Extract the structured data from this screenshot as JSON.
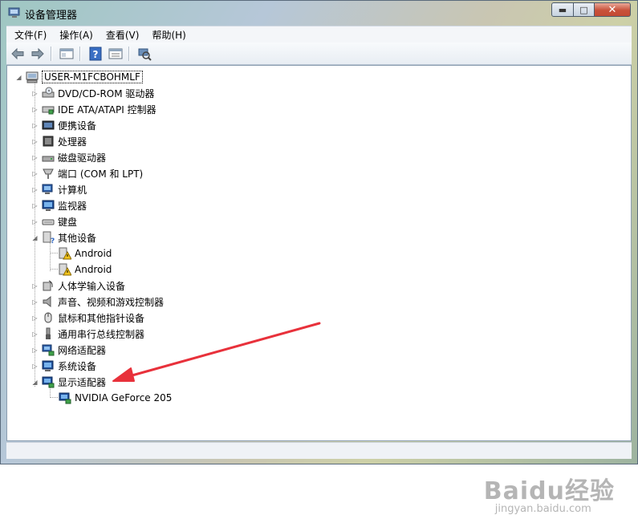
{
  "window": {
    "title": "设备管理器",
    "controls": {
      "minimize": "▬",
      "maximize": "□",
      "close": "✕"
    }
  },
  "menu": [
    "文件(F)",
    "操作(A)",
    "查看(V)",
    "帮助(H)"
  ],
  "toolbar": {
    "buttons": [
      "back-arrow-icon",
      "forward-arrow-icon",
      "properties-icon",
      "help-icon",
      "view-icon",
      "scan-hardware-icon"
    ]
  },
  "tree": {
    "root": "USER-M1FCBOHMLF",
    "items": [
      {
        "label": "DVD/CD-ROM 驱动器",
        "icon": "dvd-drive-icon",
        "state": "collapsed"
      },
      {
        "label": "IDE ATA/ATAPI 控制器",
        "icon": "ide-controller-icon",
        "state": "collapsed"
      },
      {
        "label": "便携设备",
        "icon": "portable-device-icon",
        "state": "collapsed"
      },
      {
        "label": "处理器",
        "icon": "processor-icon",
        "state": "collapsed"
      },
      {
        "label": "磁盘驱动器",
        "icon": "disk-drive-icon",
        "state": "collapsed"
      },
      {
        "label": "端口 (COM 和 LPT)",
        "icon": "port-icon",
        "state": "collapsed"
      },
      {
        "label": "计算机",
        "icon": "computer-icon",
        "state": "collapsed"
      },
      {
        "label": "监视器",
        "icon": "monitor-icon",
        "state": "collapsed"
      },
      {
        "label": "键盘",
        "icon": "keyboard-icon",
        "state": "collapsed"
      },
      {
        "label": "其他设备",
        "icon": "other-devices-icon",
        "state": "expanded",
        "children": [
          {
            "label": "Android",
            "icon": "warning-device-icon"
          },
          {
            "label": "Android",
            "icon": "warning-device-icon"
          }
        ]
      },
      {
        "label": "人体学输入设备",
        "icon": "hid-icon",
        "state": "collapsed"
      },
      {
        "label": "声音、视频和游戏控制器",
        "icon": "speaker-icon",
        "state": "collapsed"
      },
      {
        "label": "鼠标和其他指针设备",
        "icon": "mouse-icon",
        "state": "collapsed"
      },
      {
        "label": "通用串行总线控制器",
        "icon": "usb-icon",
        "state": "collapsed"
      },
      {
        "label": "网络适配器",
        "icon": "network-adapter-icon",
        "state": "collapsed"
      },
      {
        "label": "系统设备",
        "icon": "system-devices-icon",
        "state": "collapsed"
      },
      {
        "label": "显示适配器",
        "icon": "display-adapter-icon",
        "state": "expanded",
        "children": [
          {
            "label": "NVIDIA GeForce 205",
            "icon": "display-adapter-icon"
          }
        ]
      }
    ]
  },
  "annotation": {
    "color": "#e8313b",
    "points_to": "显示适配器"
  },
  "watermark": {
    "brand": "Baidu经验",
    "sub": "jingyan.baidu.com"
  },
  "colors": {
    "accent_red": "#e8313b",
    "close_button": "#c8513a",
    "window_border": "#5a6b7c"
  }
}
